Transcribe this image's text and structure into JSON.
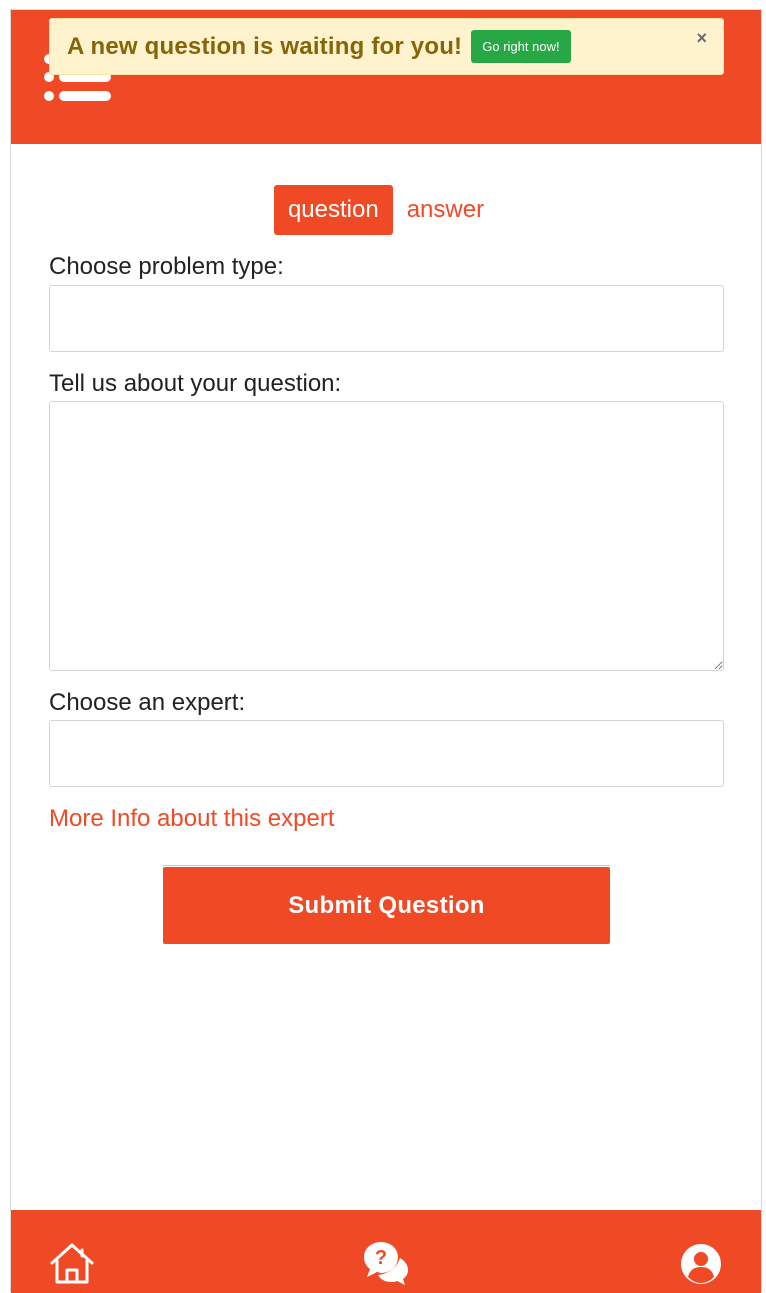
{
  "notification": {
    "message": "A new question is waiting for you!",
    "action_label": "Go right now!",
    "close_label": "×"
  },
  "header": {
    "menu_icon": "menu-list-icon"
  },
  "tabs": [
    {
      "label": "question",
      "active": true
    },
    {
      "label": "answer",
      "active": false
    }
  ],
  "form": {
    "problem_type_label": "Choose problem type:",
    "problem_type_value": "",
    "question_label": "Tell us about your question:",
    "question_value": "",
    "expert_label": "Choose an expert:",
    "expert_value": "",
    "more_info_link": "More Info about this expert",
    "submit_label": "Submit Question"
  },
  "footer": {
    "items": [
      {
        "icon": "home-icon"
      },
      {
        "icon": "questions-chat-icon"
      },
      {
        "icon": "user-profile-icon"
      }
    ]
  },
  "colors": {
    "brand": "#ef4a25",
    "notice_bg": "#fef3cd",
    "notice_text": "#866508",
    "success": "#27a844"
  }
}
